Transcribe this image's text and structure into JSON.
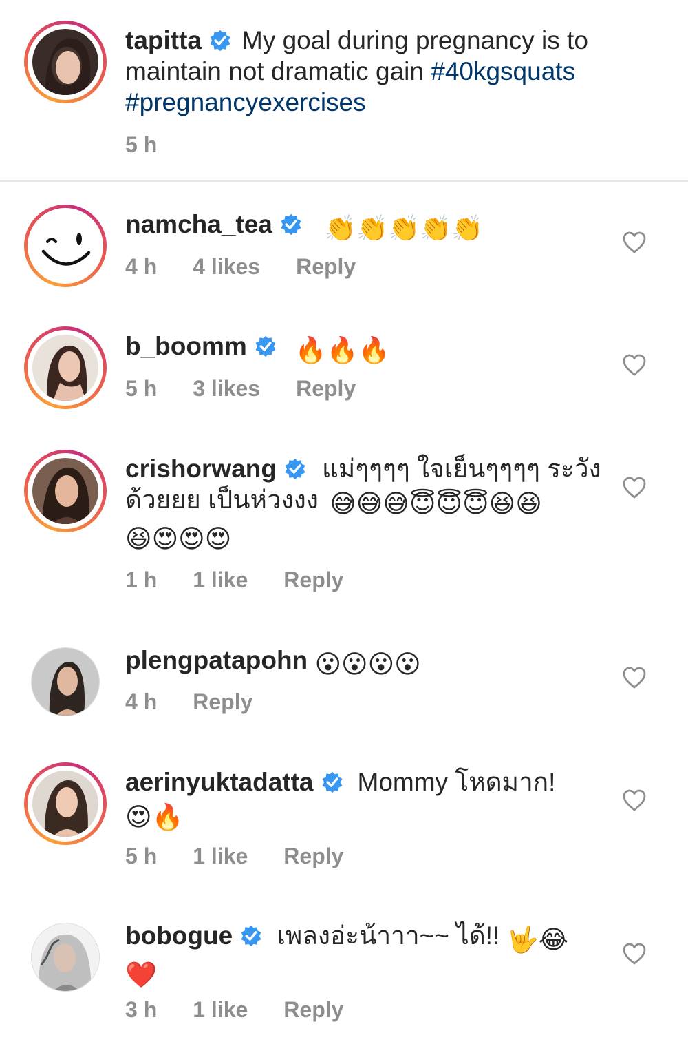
{
  "caption": {
    "username": "tapitta",
    "text": "My goal during pregnancy is to",
    "line2": "maintain not dramatic gain",
    "hashtag1": "#40kgsquats",
    "hashtag2": "#pregnancyexercises",
    "time": "5 h"
  },
  "comments": [
    {
      "username": "namcha_tea",
      "text": "",
      "emoji": "👏👏👏👏👏",
      "time": "4 h",
      "likes": "4 likes",
      "reply": "Reply"
    },
    {
      "username": "b_boomm",
      "text": "",
      "emoji": "🔥🔥🔥",
      "time": "5 h",
      "likes": "3 likes",
      "reply": "Reply"
    },
    {
      "username": "crishorwang",
      "text": "แม่ๆๆๆๆ ใจเย็นๆๆๆๆ ระวัง",
      "line2": "ด้วยยย เป็นห่วงงง",
      "emoji2": "😅😅😅😇😇😇😆😆",
      "emoji3": "😆😍😍😍",
      "time": "1 h",
      "likes": "1 like",
      "reply": "Reply"
    },
    {
      "username": "plengpatapohn",
      "text": "",
      "emoji": "😮😮😮😮",
      "time": "4 h",
      "reply": "Reply"
    },
    {
      "username": "aerinyuktadatta",
      "text": "Mommy โหดมาก!",
      "emoji2": "😍🔥",
      "time": "5 h",
      "likes": "1 like",
      "reply": "Reply"
    },
    {
      "username": "bobogue",
      "text": "เพลงอ่ะน้าาา~~ ได้!!",
      "emoji": "🤟😂",
      "emoji2": "❤️",
      "time": "3 h",
      "likes": "1 like",
      "reply": "Reply"
    }
  ],
  "colors": {
    "hashtag": "#00376b",
    "verified": "#3897f0",
    "meta": "#8e8e8e"
  },
  "icons": [
    "verified-badge-icon",
    "heart-outline-icon"
  ]
}
